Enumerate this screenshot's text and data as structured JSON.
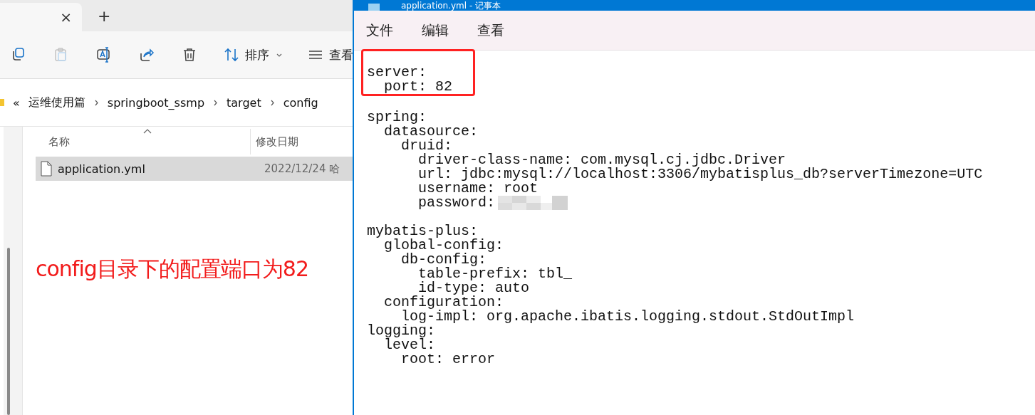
{
  "explorer": {
    "tab": {
      "close_glyph": "×",
      "new_tab_glyph": "+"
    },
    "toolbar": [
      {
        "kind": "copy",
        "disabled": false
      },
      {
        "kind": "paste",
        "disabled": true
      },
      {
        "kind": "rename",
        "disabled": false
      },
      {
        "kind": "share",
        "disabled": false
      },
      {
        "kind": "delete",
        "disabled": false
      }
    ],
    "sort": {
      "label": "排序"
    },
    "view": {
      "label": "查看"
    },
    "breadcrumb": {
      "overflow": "«",
      "items": [
        "运维使用篇",
        "springboot_ssmp",
        "target",
        "config"
      ]
    },
    "columns": [
      {
        "label": "名称",
        "sorted": true
      },
      {
        "label": "修改日期",
        "sorted": false
      }
    ],
    "files": [
      {
        "name": "application.yml",
        "modified": "2022/12/24 哈",
        "selected": true
      }
    ]
  },
  "annotation": {
    "text": "config目录下的配置端口为82"
  },
  "notepad": {
    "title": "application.yml - 记事本",
    "menu": [
      "文件",
      "编辑",
      "查看"
    ],
    "lines": [
      {
        "boxed": true
      },
      {
        "text": "server:",
        "boxed": true
      },
      {
        "text": "  port: 82",
        "boxed": true
      },
      {
        "boxed": false
      },
      {
        "text": "spring:",
        "boxed": false
      },
      {
        "text": "  datasource:",
        "boxed": false
      },
      {
        "text": "    druid:",
        "boxed": false
      },
      {
        "text": "      driver-class-name: com.mysql.cj.jdbc.Driver",
        "boxed": false
      },
      {
        "text": "      url: jdbc:mysql://localhost:3306/mybatisplus_db?serverTimezone=UTC",
        "boxed": false
      },
      {
        "text": "      username: root",
        "boxed": false
      },
      {
        "text": "      password:",
        "boxed": false,
        "redacted": true
      },
      {
        "boxed": false
      },
      {
        "text": "mybatis-plus:",
        "boxed": false
      },
      {
        "text": "  global-config:",
        "boxed": false
      },
      {
        "text": "    db-config:",
        "boxed": false
      },
      {
        "text": "      table-prefix: tbl_",
        "boxed": false
      },
      {
        "text": "      id-type: auto",
        "boxed": false
      },
      {
        "text": "  configuration:",
        "boxed": false
      },
      {
        "text": "    log-impl: org.apache.ibatis.logging.stdout.StdOutImpl",
        "boxed": false
      },
      {
        "text": "logging:",
        "boxed": false
      },
      {
        "text": "  level:",
        "boxed": false
      },
      {
        "text": "    root: error",
        "boxed": false
      }
    ]
  }
}
